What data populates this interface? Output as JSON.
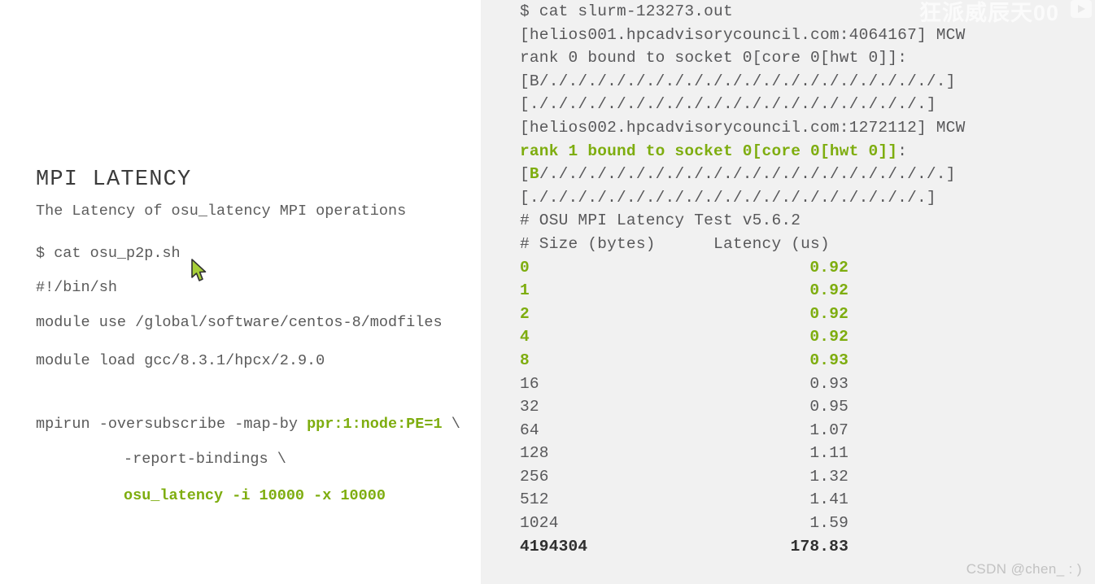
{
  "document": {
    "title": "MPI LATENCY",
    "subtitle": "The Latency of osu_latency MPI operations",
    "script_lines": [
      "$ cat osu_p2p.sh",
      "#!/bin/sh",
      "module use /global/software/centos-8/modfiles",
      "module load gcc/8.3.1/hpcx/2.9.0",
      "mpirun -oversubscribe -map-by ",
      "ppr:1:node:PE=1",
      " \\",
      "-report-bindings \\",
      "osu_latency -i 10000 -x 10000"
    ],
    "mpirun_cmd_prefix": "mpirun -oversubscribe -map-by ",
    "mpirun_cmd_highlight": "ppr:1:node:PE=1",
    "mpirun_cmd_suffix": " \\",
    "report_bindings_line": "-report-bindings \\",
    "osu_latency_line": "osu_latency -i 10000 -x 10000"
  },
  "terminal": {
    "command": "$ cat slurm-123273.out",
    "blocks": [
      {
        "header": "[helios001.hpcadvisorycouncil.com:4064167] MCW",
        "rank_line": "rank 0 bound to socket 0[core 0[hwt 0]]",
        "rank_colon": ":",
        "rank_highlighted": false,
        "binding_open": "[",
        "binding_b": "B",
        "binding_rest": "/././././././././././././././././././././.][././././././././././././././././././././.]"
      },
      {
        "header": "[helios002.hpcadvisorycouncil.com:1272112] MCW",
        "rank_line": "rank 1 bound to socket 0[core 0[hwt 0]]",
        "rank_colon": ":",
        "rank_highlighted": true,
        "binding_open": "[",
        "binding_b": "B",
        "binding_rest": "/././././././././././././././././././././.][././././././././././././././././././././.]"
      }
    ],
    "test_header": "# OSU MPI Latency Test v5.6.2",
    "table_header": "# Size (bytes)      Latency (us)",
    "table_header_col1": "# Size (bytes)",
    "table_header_col2": "Latency (us)",
    "rows": [
      {
        "size": "0",
        "latency": "0.92",
        "style": "highlight"
      },
      {
        "size": "1",
        "latency": "0.92",
        "style": "highlight"
      },
      {
        "size": "2",
        "latency": "0.92",
        "style": "highlight"
      },
      {
        "size": "4",
        "latency": "0.92",
        "style": "highlight"
      },
      {
        "size": "8",
        "latency": "0.93",
        "style": "highlight"
      },
      {
        "size": "16",
        "latency": "0.93",
        "style": "normal"
      },
      {
        "size": "32",
        "latency": "0.95",
        "style": "normal"
      },
      {
        "size": "64",
        "latency": "1.07",
        "style": "normal"
      },
      {
        "size": "128",
        "latency": "1.11",
        "style": "normal"
      },
      {
        "size": "256",
        "latency": "1.32",
        "style": "normal"
      },
      {
        "size": "512",
        "latency": "1.41",
        "style": "normal"
      },
      {
        "size": "1024",
        "latency": "1.59",
        "style": "normal"
      },
      {
        "size": "4194304",
        "latency": "178.83",
        "style": "total"
      }
    ]
  },
  "overlays": {
    "watermark_top": "狂派威辰天00",
    "watermark_prefix": "00",
    "footer_credit": "CSDN @chen_  : )"
  },
  "colors": {
    "highlight_green": "#7ead0f",
    "body_text": "#58585a",
    "terminal_background": "#f1f1f1",
    "document_background": "#ffffff",
    "cursor_fill": "#a6ce39"
  }
}
